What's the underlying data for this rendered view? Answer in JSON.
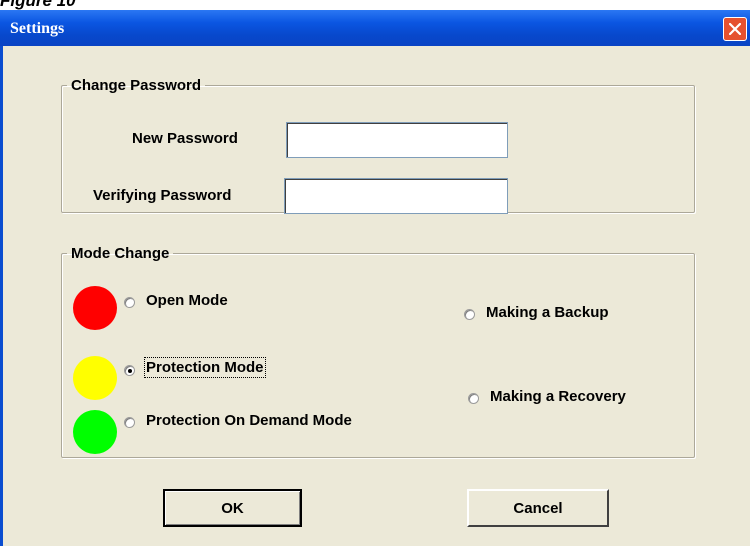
{
  "figure_label": "Figure 10",
  "window": {
    "title": "Settings",
    "close_icon": "close-x-icon"
  },
  "change_password": {
    "legend": "Change Password",
    "new_password_label": "New Password",
    "new_password_value": "",
    "verify_password_label": "Verifying Password",
    "verify_password_value": ""
  },
  "mode_change": {
    "legend": "Mode Change",
    "options": [
      {
        "label": "Open Mode",
        "indicator_color": "#ff0000",
        "selected": false
      },
      {
        "label": "Protection Mode",
        "indicator_color": "#ffff00",
        "selected": true
      },
      {
        "label": "Protection On Demand Mode",
        "indicator_color": "#00ff00",
        "selected": false
      }
    ],
    "backup_label": "Making a Backup",
    "recovery_label": "Making a Recovery"
  },
  "buttons": {
    "ok_label": "OK",
    "cancel_label": "Cancel"
  },
  "colors": {
    "titlebar": "#0b56e2",
    "close_button": "#e5512f",
    "dialog_background": "#ece9d8"
  }
}
